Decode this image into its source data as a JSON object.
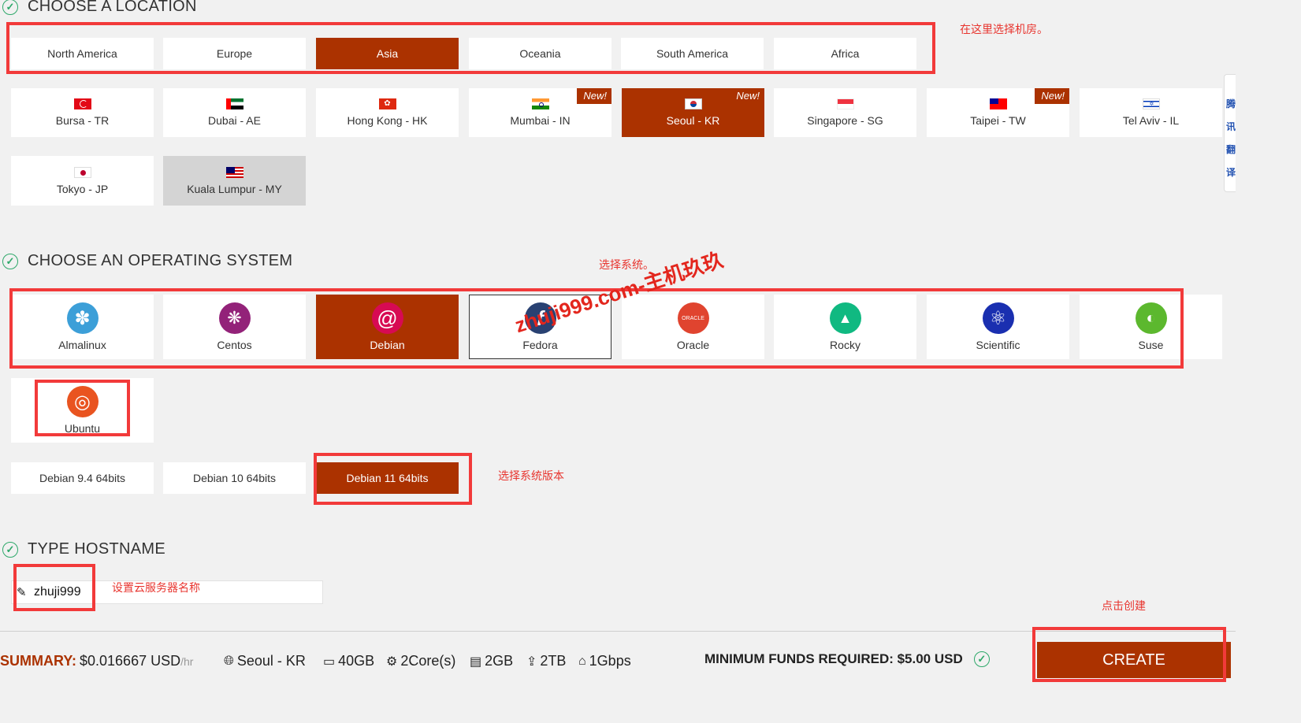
{
  "sections": {
    "location_title": "CHOOSE A LOCATION",
    "os_title": "CHOOSE AN OPERATING SYSTEM",
    "hostname_title": "TYPE HOSTNAME"
  },
  "regions": [
    {
      "label": "North America",
      "selected": false
    },
    {
      "label": "Europe",
      "selected": false
    },
    {
      "label": "Asia",
      "selected": true
    },
    {
      "label": "Oceania",
      "selected": false
    },
    {
      "label": "South America",
      "selected": false
    },
    {
      "label": "Africa",
      "selected": false
    }
  ],
  "locations": [
    {
      "label": "Bursa - TR",
      "flag": "flag-tr-icon",
      "new": false
    },
    {
      "label": "Dubai - AE",
      "flag": "flag-ae-icon",
      "new": false
    },
    {
      "label": "Hong Kong - HK",
      "flag": "flag-hk-icon",
      "new": false
    },
    {
      "label": "Mumbai - IN",
      "flag": "flag-in-icon",
      "new": true
    },
    {
      "label": "Seoul - KR",
      "flag": "flag-kr-icon",
      "new": true,
      "selected": true
    },
    {
      "label": "Singapore - SG",
      "flag": "flag-sg-icon",
      "new": false
    },
    {
      "label": "Taipei - TW",
      "flag": "flag-tw-icon",
      "new": true
    },
    {
      "label": "Tel Aviv - IL",
      "flag": "flag-il-icon",
      "new": false
    },
    {
      "label": "Tokyo - JP",
      "flag": "flag-jp-icon",
      "new": false
    },
    {
      "label": "Kuala Lumpur - MY",
      "flag": "flag-my-icon",
      "new": false,
      "disabled": true
    }
  ],
  "new_badge": "New!",
  "operating_systems": [
    {
      "label": "Almalinux",
      "icon": "almalinux-logo-icon"
    },
    {
      "label": "Centos",
      "icon": "centos-logo-icon"
    },
    {
      "label": "Debian",
      "icon": "debian-logo-icon",
      "selected": true
    },
    {
      "label": "Fedora",
      "icon": "fedora-logo-icon",
      "hovered": true
    },
    {
      "label": "Oracle",
      "icon": "oracle-logo-icon"
    },
    {
      "label": "Rocky",
      "icon": "rocky-logo-icon"
    },
    {
      "label": "Scientific",
      "icon": "scientific-logo-icon"
    },
    {
      "label": "Suse",
      "icon": "suse-logo-icon"
    },
    {
      "label": "Ubuntu",
      "icon": "ubuntu-logo-icon"
    }
  ],
  "oracle_logo_text": "ORACLE",
  "versions": [
    {
      "label": "Debian 9.4 64bits",
      "selected": false
    },
    {
      "label": "Debian 10 64bits",
      "selected": false
    },
    {
      "label": "Debian 11 64bits",
      "selected": true
    }
  ],
  "hostname": {
    "value": "zhuji999"
  },
  "summary": {
    "label": "SUMMARY:",
    "price": "$0.016667 USD",
    "per": "/hr",
    "location": "Seoul - KR",
    "disk": "40GB",
    "cpu": "2Core(s)",
    "ram": "2GB",
    "transfer": "2TB",
    "bandwidth": "1Gbps",
    "min_funds": "MINIMUM FUNDS REQUIRED: $5.00 USD"
  },
  "create_label": "CREATE",
  "side_tab_chars": [
    "腾",
    "讯",
    "翻",
    "译"
  ],
  "annotations": {
    "location": "在这里选择机房。",
    "os": "选择系统。",
    "version": "选择系统版本",
    "hostname": "设置云服务器名称",
    "create": "点击创建",
    "watermark": "zhuji999.com-主机玖玖"
  },
  "colors": {
    "accent": "#ab3200",
    "annotation": "#f23a3a",
    "check": "#2ea86a"
  }
}
